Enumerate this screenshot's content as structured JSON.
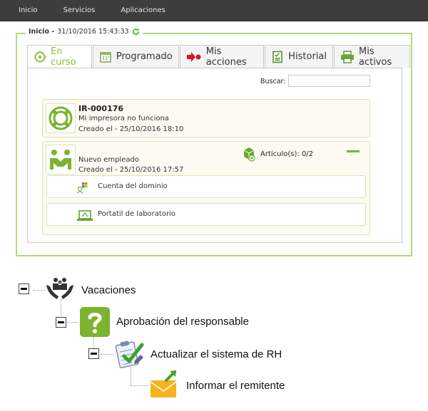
{
  "nav": {
    "items": [
      "Inicio",
      "Servicios",
      "Aplicaciones"
    ]
  },
  "header": {
    "label": "Inicio -",
    "timestamp": "31/10/2016 15:43:33"
  },
  "tabs": [
    {
      "label": "En curso",
      "icon": "activity-icon",
      "active": true
    },
    {
      "label": "Programado",
      "icon": "calendar-icon"
    },
    {
      "label": "Mis acciones",
      "icon": "actions-icon"
    },
    {
      "label": "Historial",
      "icon": "history-icon"
    },
    {
      "label": "Mis activos",
      "icon": "printer-icon"
    }
  ],
  "search": {
    "label": "Buscar:",
    "value": ""
  },
  "requests": [
    {
      "id": "IR-000176",
      "title": "Mi impresora no funciona",
      "created": "Creado el - 25/10/2016 18:10",
      "icon": "lifebuoy-icon"
    },
    {
      "title": "Nuevo empleado",
      "created": "Creado el - 25/10/2016 17:57",
      "icon": "handshake-icon",
      "articles": "Artículo(s): 0/2",
      "items": [
        {
          "label": "Cuenta del dominio",
          "icon": "domain-account-icon"
        },
        {
          "label": "Portatil de laboratorio",
          "icon": "laptop-icon"
        }
      ]
    }
  ],
  "tree": [
    {
      "label": "Vacaciones",
      "icon": "people-hands-icon"
    },
    {
      "label": "Aprobación del responsable",
      "icon": "question-icon"
    },
    {
      "label": "Actualizar el sistema de RH",
      "icon": "checklist-icon"
    },
    {
      "label": "Informar el remitente",
      "icon": "envelope-icon"
    }
  ],
  "colors": {
    "accent": "#8bbf3c",
    "border": "#b6d77a",
    "topbar": "#3d3d3d"
  }
}
